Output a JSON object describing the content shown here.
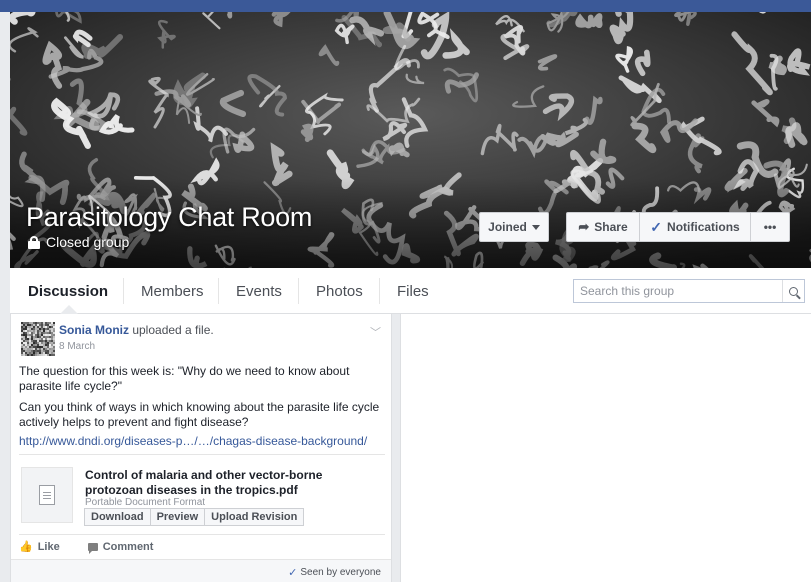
{
  "group": {
    "title": "Parasitology Chat Room",
    "privacy": "Closed group"
  },
  "header_buttons": {
    "joined": "Joined",
    "share": "Share",
    "notifications": "Notifications",
    "more": "•••"
  },
  "tabs": [
    {
      "label": "Discussion",
      "active": true
    },
    {
      "label": "Members"
    },
    {
      "label": "Events"
    },
    {
      "label": "Photos"
    },
    {
      "label": "Files"
    }
  ],
  "search": {
    "placeholder": "Search this group"
  },
  "post": {
    "author": "Sonia Moniz",
    "action": " uploaded a file.",
    "date": "8 March",
    "text1": "The question for this week is: \"Why do we need to know about parasite life cycle?\"",
    "text2": "Can you think of ways in which knowing about the parasite life cycle actively helps to prevent and fight disease?",
    "link": "http://www.dndi.org/diseases-p…/…/chagas-disease-background/",
    "file": {
      "name": "Control of malaria and other vector-borne protozoan diseases in the tropics.pdf",
      "type": "Portable Document Format",
      "buttons": [
        "Download",
        "Preview",
        "Upload Revision"
      ]
    },
    "actions": {
      "like": "Like",
      "comment": "Comment"
    },
    "seen": "Seen by everyone"
  },
  "colors": {
    "brand": "#3b5998",
    "link": "#365899",
    "check": "#4267b2"
  }
}
